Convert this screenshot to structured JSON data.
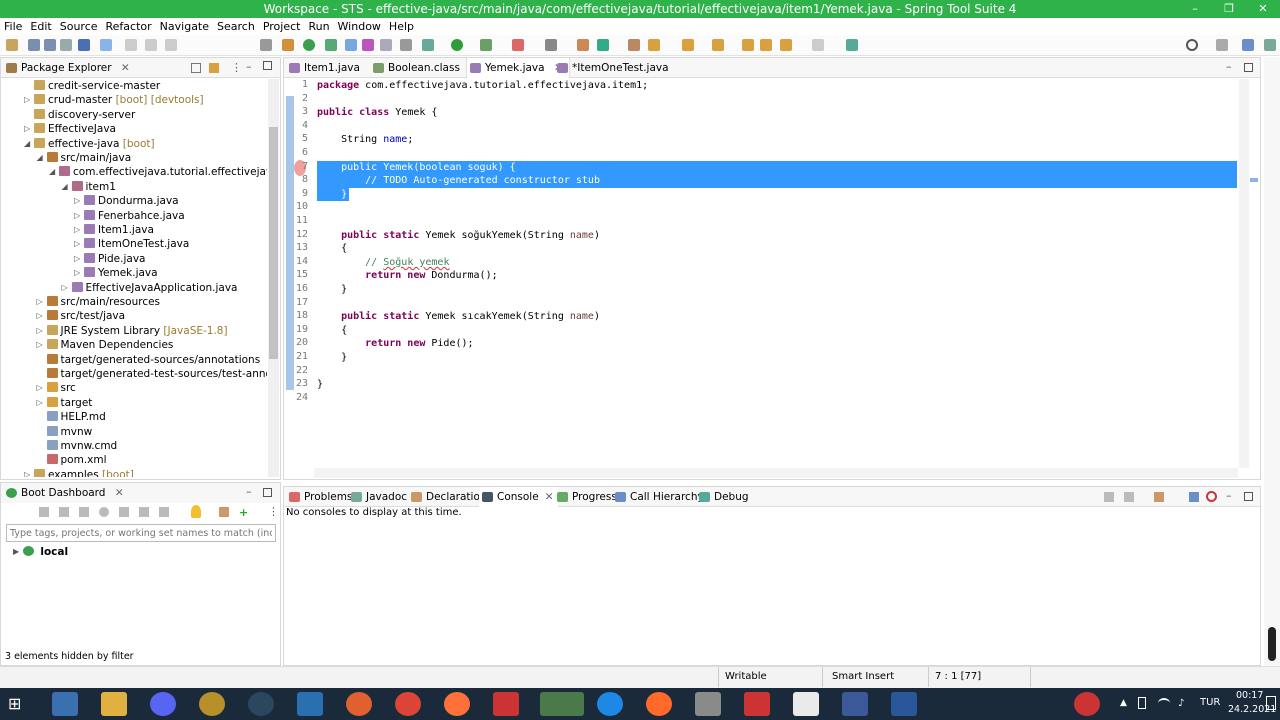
{
  "window": {
    "title": "Workspace - STS - effective-java/src/main/java/com/effectivejava/tutorial/effectivejava/item1/Yemek.java - Spring Tool Suite 4"
  },
  "menu": [
    "File",
    "Edit",
    "Source",
    "Refactor",
    "Navigate",
    "Search",
    "Project",
    "Run",
    "Window",
    "Help"
  ],
  "package_explorer": {
    "title": "Package Explorer",
    "tree": [
      {
        "label": "credit-service-master",
        "dec": ""
      },
      {
        "label": "crud-master",
        "dec": " [boot] [devtools]"
      },
      {
        "label": "discovery-server",
        "dec": ""
      },
      {
        "label": "EffectiveJava",
        "dec": ""
      },
      {
        "label": "effective-java",
        "dec": " [boot]"
      },
      {
        "label": "src/main/java",
        "dec": ""
      },
      {
        "label": "com.effectivejava.tutorial.effectivejava",
        "dec": ""
      },
      {
        "label": "item1",
        "dec": ""
      },
      {
        "label": "Dondurma.java",
        "dec": ""
      },
      {
        "label": "Fenerbahce.java",
        "dec": ""
      },
      {
        "label": "Item1.java",
        "dec": ""
      },
      {
        "label": "ItemOneTest.java",
        "dec": ""
      },
      {
        "label": "Pide.java",
        "dec": ""
      },
      {
        "label": "Yemek.java",
        "dec": ""
      },
      {
        "label": "EffectiveJavaApplication.java",
        "dec": ""
      },
      {
        "label": "src/main/resources",
        "dec": ""
      },
      {
        "label": "src/test/java",
        "dec": ""
      },
      {
        "label": "JRE System Library",
        "dec": " [JavaSE-1.8]"
      },
      {
        "label": "Maven Dependencies",
        "dec": ""
      },
      {
        "label": "target/generated-sources/annotations",
        "dec": ""
      },
      {
        "label": "target/generated-test-sources/test-annotations",
        "dec": ""
      },
      {
        "label": "src",
        "dec": ""
      },
      {
        "label": "target",
        "dec": ""
      },
      {
        "label": "HELP.md",
        "dec": ""
      },
      {
        "label": "mvnw",
        "dec": ""
      },
      {
        "label": "mvnw.cmd",
        "dec": ""
      },
      {
        "label": "pom.xml",
        "dec": ""
      },
      {
        "label": "examples",
        "dec": " [boot]"
      }
    ]
  },
  "boot_dashboard": {
    "title": "Boot Dashboard",
    "filter_placeholder": "Type tags, projects, or working set names to match (incl. * and",
    "local_label": "local",
    "footer": "3 elements hidden by filter"
  },
  "editor": {
    "tabs": [
      "Item1.java",
      "Boolean.class",
      "Yemek.java",
      "*ItemOneTest.java"
    ],
    "line_numbers": [
      "1",
      "2",
      "3",
      "4",
      "5",
      "6",
      "7",
      "8",
      "9",
      "10",
      "11",
      "12",
      "13",
      "14",
      "15",
      "16",
      "17",
      "18",
      "19",
      "20",
      "21",
      "22",
      "23",
      "24"
    ],
    "lines": {
      "l1a": "package ",
      "l1b": "com.effectivejava.tutorial.effectivejava.item1;",
      "l3a": "public class ",
      "l3b": "Yemek {",
      "l5a": "    String ",
      "l5b": "name",
      "l5c": ";",
      "l7": "    public Yemek(boolean soguk) {",
      "l8": "        // TODO Auto-generated constructor stub",
      "l9": "    }",
      "l12a": "    public static ",
      "l12b": "Yemek soğukYemek(String ",
      "l12c": "name",
      "l12d": ")",
      "l13": "    {",
      "l14a": "        // ",
      "l14b": "Soğuk yemek",
      "l15a": "        return new ",
      "l15b": "Dondurma();",
      "l16": "    }",
      "l18a": "    public static ",
      "l18b": "Yemek sıcakYemek(String ",
      "l18c": "name",
      "l18d": ")",
      "l19": "    {",
      "l20a": "        return new ",
      "l20b": "Pide();",
      "l21": "    }",
      "l23": "}"
    }
  },
  "bottom_panel": {
    "tabs": [
      "Problems",
      "Javadoc",
      "Declaration",
      "Console",
      "Progress",
      "Call Hierarchy",
      "Debug"
    ],
    "message": "No consoles to display at this time."
  },
  "status": {
    "writable": "Writable",
    "insert_mode": "Smart Insert",
    "position": "7 : 1 [77]"
  },
  "taskbar": {
    "lang": "TUR",
    "time": "00:17",
    "date": "24.2.2021"
  },
  "colors": {
    "title_green": "#2fb24a",
    "selection": "#3399ff",
    "keyword": "#7f0055",
    "comment": "#3f7f5f",
    "field": "#0000c0"
  }
}
